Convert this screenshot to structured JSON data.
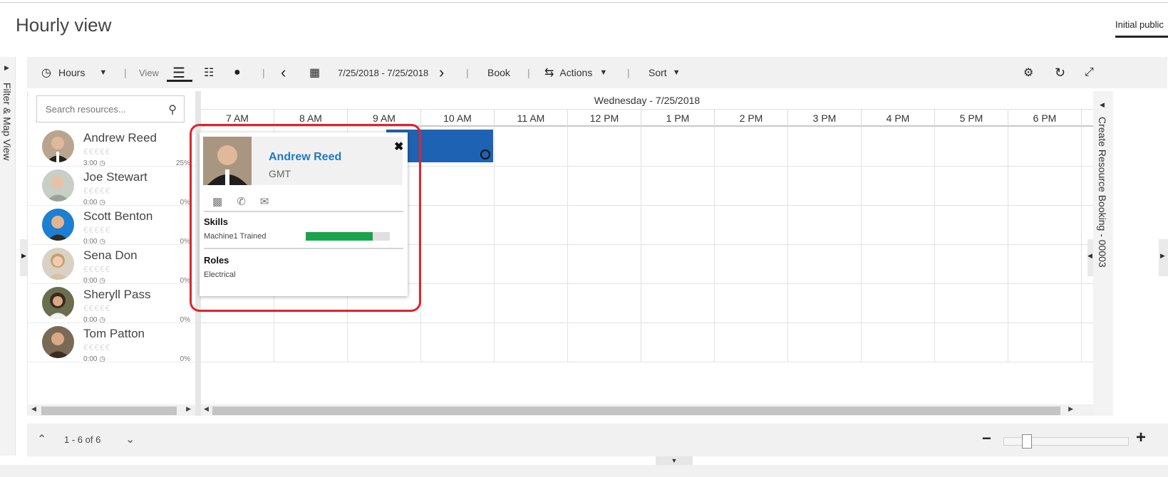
{
  "page": {
    "title": "Hourly view",
    "tab_label": "Initial public"
  },
  "left_rail": {
    "label": "Filter & Map View"
  },
  "toolbar": {
    "hours_label": "Hours",
    "view_label": "View",
    "date_range": "7/25/2018 - 7/25/2018",
    "book_label": "Book",
    "actions_label": "Actions",
    "sort_label": "Sort"
  },
  "search": {
    "placeholder": "Search resources..."
  },
  "resources": [
    {
      "name": "Andrew Reed",
      "stars": "€€€€€",
      "hours": "3:00",
      "pct": "25%"
    },
    {
      "name": "Joe Stewart",
      "stars": "€€€€€",
      "hours": "0:00",
      "pct": "0%"
    },
    {
      "name": "Scott Benton",
      "stars": "€€€€€",
      "hours": "0:00",
      "pct": "0%"
    },
    {
      "name": "Sena Don",
      "stars": "€€€€€",
      "hours": "0:00",
      "pct": "0%"
    },
    {
      "name": "Sheryll Pass",
      "stars": "€€€€€",
      "hours": "0:00",
      "pct": "0%"
    },
    {
      "name": "Tom Patton",
      "stars": "€€€€€",
      "hours": "0:00",
      "pct": "0%"
    }
  ],
  "grid": {
    "date": "Wednesday - 7/25/2018",
    "hours": [
      "7 AM",
      "8 AM",
      "9 AM",
      "10 AM",
      "11 AM",
      "12 PM",
      "1 PM",
      "2 PM",
      "3 PM",
      "4 PM",
      "5 PM",
      "6 PM"
    ]
  },
  "right_rail": {
    "label": "Create Resource Booking - 00003"
  },
  "footer": {
    "pager": "1 - 6 of 6"
  },
  "popup": {
    "name": "Andrew Reed",
    "timezone": "GMT",
    "skills_title": "Skills",
    "skill_name": "Machine1 Trained",
    "skill_level": 0.8,
    "roles_title": "Roles",
    "role_name": "Electrical"
  },
  "colors": {
    "booking": "#1e63b3",
    "link": "#1f7ac4",
    "skill": "#1aa34a",
    "highlight": "#e1232b"
  }
}
